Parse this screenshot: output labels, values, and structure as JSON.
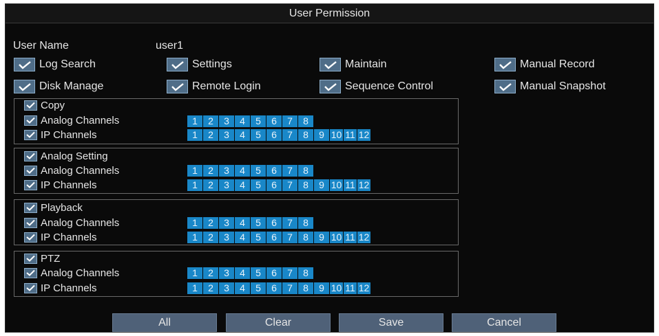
{
  "dialog": {
    "title": "User Permission"
  },
  "user": {
    "name_label": "User Name",
    "name_value": "user1"
  },
  "permissions": [
    {
      "label": "Log Search",
      "checked": true
    },
    {
      "label": "Settings",
      "checked": true
    },
    {
      "label": "Maintain",
      "checked": true
    },
    {
      "label": "Manual Record",
      "checked": true
    },
    {
      "label": "Disk Manage",
      "checked": true
    },
    {
      "label": "Remote Login",
      "checked": true
    },
    {
      "label": "Sequence Control",
      "checked": true
    },
    {
      "label": "Manual Snapshot",
      "checked": true
    }
  ],
  "groups": [
    {
      "title": "Copy",
      "checked": true
    },
    {
      "title": "Analog Setting",
      "checked": true
    },
    {
      "title": "Playback",
      "checked": true
    },
    {
      "title": "PTZ",
      "checked": true
    }
  ],
  "rows": {
    "analog_label": "Analog Channels",
    "ip_label": "IP Channels"
  },
  "analog_channels": [
    "1",
    "2",
    "3",
    "4",
    "5",
    "6",
    "7",
    "8"
  ],
  "ip_channels": [
    "1",
    "2",
    "3",
    "4",
    "5",
    "6",
    "7",
    "8",
    "9",
    "10",
    "11",
    "12"
  ],
  "buttons": {
    "all": "All",
    "clear": "Clear",
    "save": "Save",
    "cancel": "Cancel"
  },
  "colors": {
    "channel_selected": "#1987c8",
    "checkbox": "#4f6d88",
    "button": "#4f6178",
    "background": "#0a0a0a"
  }
}
